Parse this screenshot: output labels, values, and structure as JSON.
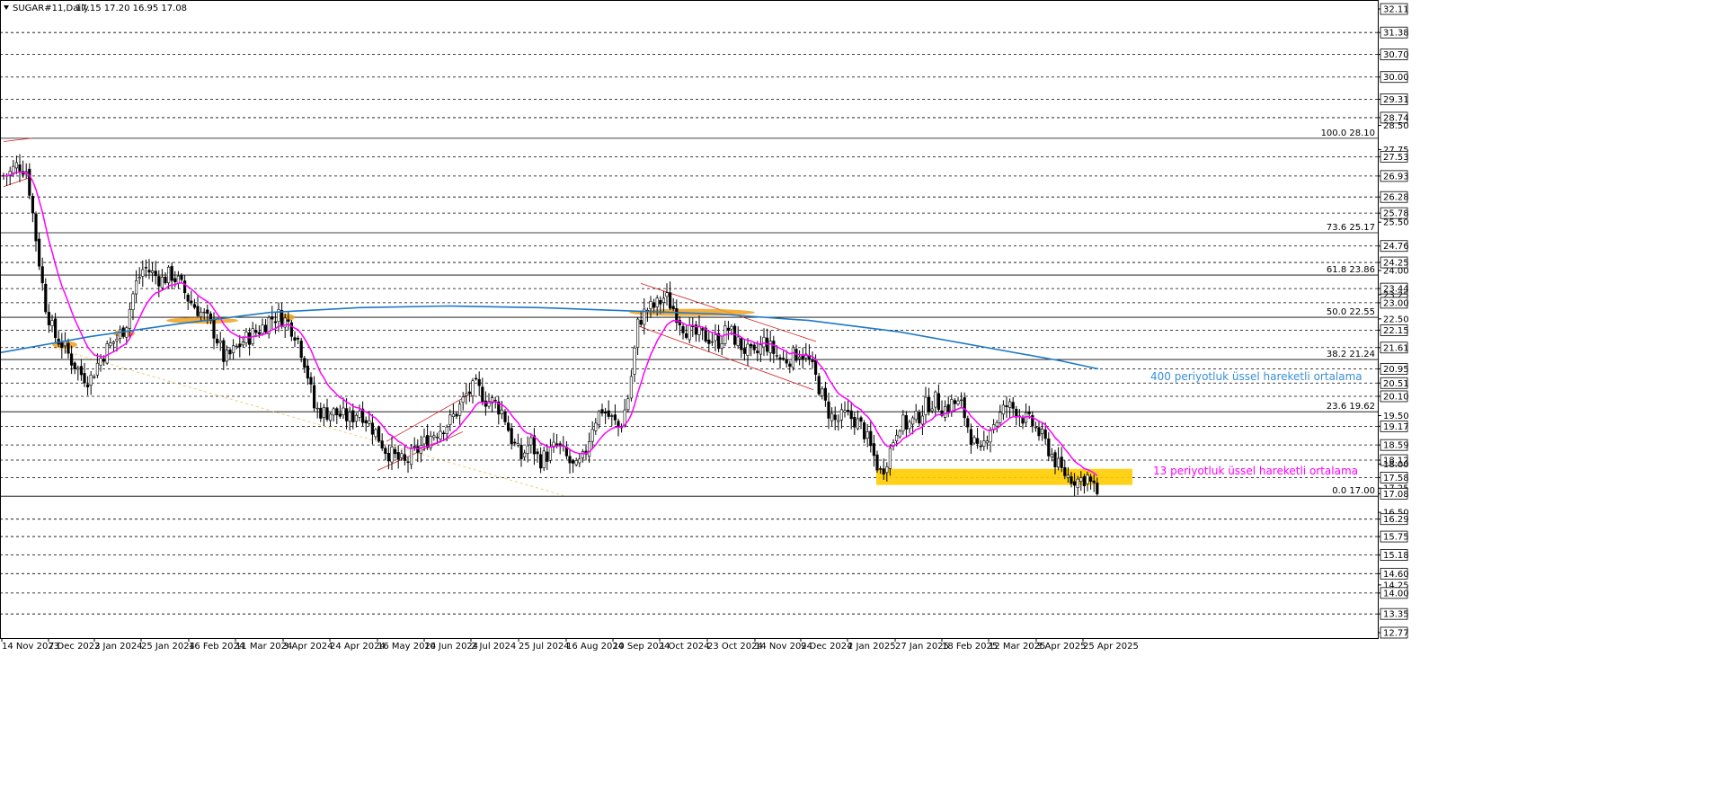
{
  "chart_data": {
    "type": "candlestick",
    "header": {
      "symbol_text": "SUGAR#11,Daily",
      "ohlc_text": "17.15 17.20 16.95 17.08"
    },
    "ylim": [
      12.77,
      32.11
    ],
    "y_tick_labels": [
      "32.11",
      "31.38",
      "30.70",
      "30.00",
      "29.31",
      "28.74",
      "28.50",
      "27.75",
      "27.53",
      "26.93",
      "26.28",
      "25.78",
      "25.50",
      "24.76",
      "24.25",
      "24.00",
      "23.44",
      "23.25",
      "23.00",
      "22.50",
      "22.15",
      "21.61",
      "20.95",
      "20.51",
      "20.10",
      "19.50",
      "19.17",
      "18.59",
      "18.12",
      "18.00",
      "17.58",
      "17.25",
      "17.08",
      "16.50",
      "16.29",
      "15.75",
      "15.18",
      "14.60",
      "14.25",
      "14.00",
      "13.35",
      "12.77"
    ],
    "y_boxed_labels": [
      "32.11",
      "31.38",
      "30.70",
      "30.00",
      "29.31",
      "28.74",
      "27.53",
      "26.93",
      "26.28",
      "25.78",
      "24.76",
      "24.25",
      "23.44",
      "23.00",
      "22.15",
      "21.61",
      "20.95",
      "20.51",
      "20.10",
      "19.17",
      "18.59",
      "18.12",
      "17.58",
      "17.08",
      "16.29",
      "15.75",
      "15.18",
      "14.60",
      "14.00",
      "13.35",
      "12.77"
    ],
    "horizontal_levels": [
      31.38,
      30.7,
      30.0,
      29.31,
      28.74,
      27.53,
      26.93,
      26.28,
      25.78,
      24.76,
      24.25,
      23.44,
      23.0,
      22.15,
      21.61,
      20.95,
      20.51,
      20.1,
      19.17,
      18.59,
      18.12,
      17.58,
      16.29,
      15.75,
      15.18,
      14.6,
      14.0,
      13.35
    ],
    "x_labels": [
      "14 Nov 2023",
      "7 Dec 2023",
      "2 Jan 2024",
      "25 Jan 2024",
      "16 Feb 2024",
      "11 Mar 2024",
      "3 Apr 2024",
      "24 Apr 2024",
      "16 May 2024",
      "10 Jun 2024",
      "2 Jul 2024",
      "25 Jul 2024",
      "16 Aug 2024",
      "10 Sep 2024",
      "1 Oct 2024",
      "23 Oct 2024",
      "14 Nov 2024",
      "9 Dec 2024",
      "2 Jan 2025",
      "27 Jan 2025",
      "18 Feb 2025",
      "12 Mar 2025",
      "3 Apr 2025",
      "25 Apr 2025"
    ],
    "fibonacci": [
      {
        "label": "100.0 28.10",
        "value": 28.1
      },
      {
        "label": "73.6 25.17",
        "value": 25.17
      },
      {
        "label": "61.8 23.86",
        "value": 23.86
      },
      {
        "label": "50.0 22.55",
        "value": 22.55
      },
      {
        "label": "38.2 21.24",
        "value": 21.24
      },
      {
        "label": "23.6 19.62",
        "value": 19.62
      },
      {
        "label": "0.0 17.00",
        "value": 17.0
      }
    ],
    "price_path": [
      [
        0,
        26.9
      ],
      [
        10,
        27.0
      ],
      [
        20,
        27.3
      ],
      [
        30,
        27.1
      ],
      [
        40,
        25.0
      ],
      [
        50,
        23.0
      ],
      [
        60,
        22.0
      ],
      [
        70,
        21.7
      ],
      [
        80,
        21.2
      ],
      [
        90,
        20.8
      ],
      [
        100,
        20.6
      ],
      [
        110,
        21.2
      ],
      [
        120,
        21.6
      ],
      [
        130,
        21.9
      ],
      [
        140,
        22.3
      ],
      [
        150,
        23.5
      ],
      [
        160,
        24.1
      ],
      [
        170,
        23.9
      ],
      [
        180,
        23.7
      ],
      [
        190,
        23.9
      ],
      [
        200,
        23.6
      ],
      [
        210,
        23.1
      ],
      [
        220,
        22.8
      ],
      [
        230,
        22.5
      ],
      [
        240,
        22.0
      ],
      [
        250,
        21.2
      ],
      [
        260,
        21.5
      ],
      [
        270,
        21.8
      ],
      [
        280,
        22.0
      ],
      [
        290,
        22.2
      ],
      [
        300,
        22.5
      ],
      [
        310,
        22.6
      ],
      [
        320,
        22.4
      ],
      [
        330,
        22.0
      ],
      [
        340,
        21.1
      ],
      [
        350,
        19.7
      ],
      [
        360,
        19.6
      ],
      [
        370,
        19.6
      ],
      [
        380,
        19.5
      ],
      [
        390,
        19.4
      ],
      [
        400,
        19.7
      ],
      [
        410,
        19.3
      ],
      [
        420,
        18.9
      ],
      [
        430,
        18.4
      ],
      [
        440,
        18.2
      ],
      [
        450,
        18.0
      ],
      [
        460,
        18.3
      ],
      [
        470,
        18.6
      ],
      [
        480,
        18.9
      ],
      [
        490,
        19.1
      ],
      [
        500,
        19.3
      ],
      [
        510,
        19.7
      ],
      [
        520,
        20.2
      ],
      [
        530,
        20.4
      ],
      [
        540,
        20.0
      ],
      [
        550,
        19.9
      ],
      [
        560,
        19.6
      ],
      [
        570,
        18.7
      ],
      [
        580,
        18.2
      ],
      [
        590,
        18.7
      ],
      [
        600,
        18.1
      ],
      [
        610,
        18.3
      ],
      [
        620,
        18.6
      ],
      [
        630,
        18.2
      ],
      [
        640,
        17.8
      ],
      [
        650,
        18.2
      ],
      [
        660,
        19.3
      ],
      [
        670,
        19.7
      ],
      [
        680,
        19.4
      ],
      [
        690,
        19.1
      ],
      [
        700,
        20.2
      ],
      [
        710,
        22.4
      ],
      [
        720,
        22.8
      ],
      [
        730,
        22.9
      ],
      [
        740,
        23.2
      ],
      [
        750,
        22.8
      ],
      [
        760,
        22.3
      ],
      [
        770,
        22.0
      ],
      [
        780,
        22.0
      ],
      [
        790,
        21.9
      ],
      [
        800,
        21.8
      ],
      [
        810,
        22.2
      ],
      [
        820,
        21.8
      ],
      [
        830,
        21.5
      ],
      [
        840,
        21.3
      ],
      [
        850,
        21.8
      ],
      [
        860,
        21.5
      ],
      [
        870,
        21.2
      ],
      [
        880,
        21.3
      ],
      [
        890,
        21.5
      ],
      [
        900,
        21.2
      ],
      [
        910,
        20.5
      ],
      [
        920,
        19.7
      ],
      [
        930,
        19.3
      ],
      [
        940,
        19.5
      ],
      [
        950,
        19.4
      ],
      [
        960,
        19.1
      ],
      [
        970,
        18.4
      ],
      [
        980,
        17.7
      ],
      [
        990,
        18.4
      ],
      [
        1000,
        19.3
      ],
      [
        1010,
        19.2
      ],
      [
        1020,
        19.4
      ],
      [
        1030,
        19.8
      ],
      [
        1040,
        20.0
      ],
      [
        1050,
        19.7
      ],
      [
        1060,
        19.9
      ],
      [
        1070,
        19.8
      ],
      [
        1080,
        18.9
      ],
      [
        1090,
        18.2
      ],
      [
        1100,
        19.1
      ],
      [
        1110,
        19.4
      ],
      [
        1120,
        19.8
      ],
      [
        1130,
        19.7
      ],
      [
        1140,
        19.4
      ],
      [
        1150,
        19.2
      ],
      [
        1160,
        18.8
      ],
      [
        1170,
        18.3
      ],
      [
        1180,
        17.8
      ],
      [
        1190,
        17.6
      ],
      [
        1200,
        17.5
      ],
      [
        1210,
        17.6
      ],
      [
        1215,
        17.3
      ],
      [
        1222,
        17.08
      ]
    ],
    "ema13_color": "#ff00ff",
    "ema400_color": "#1e78c8",
    "fib_color": "#000000",
    "highlight_color": "#ffcc00",
    "annotations": [
      {
        "text": "400 periyotluk üssel hareketli ortalama",
        "color": "#3a8fd6"
      },
      {
        "text": "13 periyotluk üssel hareketli ortalama",
        "color": "#ff00ff"
      }
    ]
  }
}
